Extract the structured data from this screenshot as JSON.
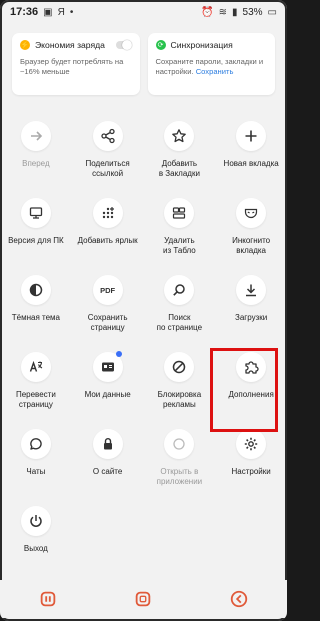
{
  "status": {
    "time": "17:36",
    "battery": "53%"
  },
  "cards": {
    "battery": {
      "title": "Экономия заряда",
      "text": "Браузер будет потреблять на ~16% меньше"
    },
    "sync": {
      "title": "Синхронизация",
      "text": "Сохраните пароли, закладки и настройки.",
      "link": "Сохранить"
    }
  },
  "menu": [
    {
      "label": "Вперед"
    },
    {
      "label": "Поделиться\nссылкой"
    },
    {
      "label": "Добавить\nв Закладки"
    },
    {
      "label": "Новая вкладка"
    },
    {
      "label": "Версия для ПК"
    },
    {
      "label": "Добавить ярлык"
    },
    {
      "label": "Удалить\nиз Табло"
    },
    {
      "label": "Инкогнито\nвкладка"
    },
    {
      "label": "Тёмная тема"
    },
    {
      "label": "Сохранить\nстраницу",
      "icon_text": "PDF"
    },
    {
      "label": "Поиск\nпо странице"
    },
    {
      "label": "Загрузки"
    },
    {
      "label": "Перевести\nстраницу"
    },
    {
      "label": "Мои данные"
    },
    {
      "label": "Блокировка\nрекламы"
    },
    {
      "label": "Дополнения"
    },
    {
      "label": "Чаты"
    },
    {
      "label": "О сайте"
    },
    {
      "label": "Открыть в\nприложении"
    },
    {
      "label": "Настройки"
    },
    {
      "label": "Выход"
    }
  ],
  "colors": {
    "highlight": "#dd1111",
    "link": "#2f7fe0",
    "badge": "#3a6ff7",
    "nav_accent": "#e05a3a"
  }
}
